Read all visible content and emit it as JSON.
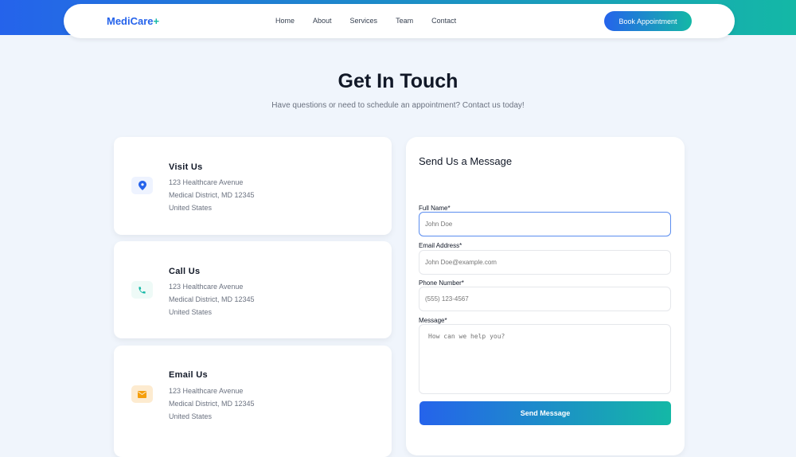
{
  "nav": {
    "logo": "MediCare",
    "logo_plus": "+",
    "links": [
      "Home",
      "About",
      "Services",
      "Team",
      "Contact"
    ],
    "cta": "Book Appointment"
  },
  "hero": {
    "title": "Get In Touch",
    "subtitle": "Have questions or need to schedule an appointment? Contact us today!"
  },
  "cards": [
    {
      "title": "Visit Us",
      "icon": "map-pin-icon",
      "lines": [
        "123 Healthcare Avenue",
        "Medical District, MD 12345",
        "United States"
      ]
    },
    {
      "title": "Call Us",
      "icon": "phone-icon",
      "lines": [
        "123 Healthcare Avenue",
        "Medical District, MD 12345",
        "United States"
      ]
    },
    {
      "title": "Email Us",
      "icon": "envelope-icon",
      "lines": [
        "123 Healthcare Avenue",
        "Medical District, MD 12345",
        "United States"
      ]
    }
  ],
  "form": {
    "title": "Send Us a Message",
    "fields": [
      {
        "label": "Full Name*",
        "placeholder": "John Doe"
      },
      {
        "label": "Email Address*",
        "placeholder": "John Doe@example.com"
      },
      {
        "label": "Phone Number*",
        "placeholder": "(555) 123-4567"
      },
      {
        "label": "Message*",
        "placeholder": "How can we help you?"
      }
    ],
    "submit": "Send Message"
  },
  "colors": {
    "primary": "#2563eb",
    "accent": "#14b8a6",
    "amber": "#f59e0b"
  }
}
